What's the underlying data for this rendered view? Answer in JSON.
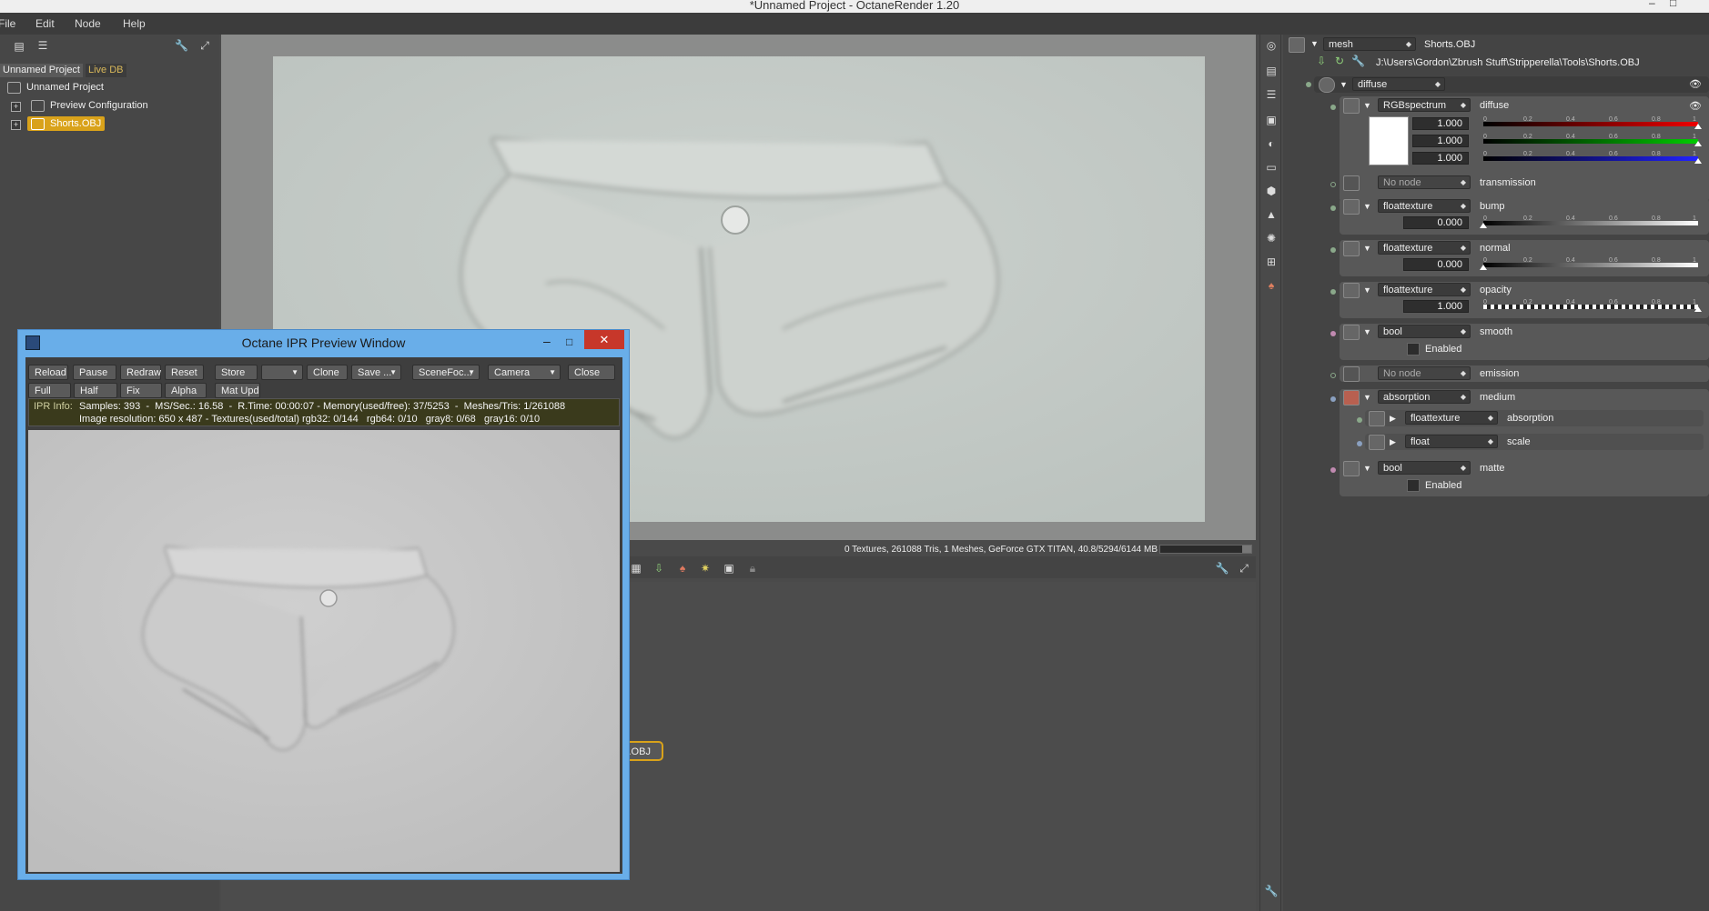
{
  "window": {
    "title": "*Unnamed Project - OctaneRender 1.20",
    "controls": {
      "minimize": "–",
      "maximize": "□"
    }
  },
  "menu": [
    "File",
    "Edit",
    "Node",
    "Help"
  ],
  "left_panel": {
    "tabs": [
      "Unnamed Project",
      "Live DB"
    ],
    "tree": {
      "root": "Unnamed Project",
      "children": [
        "Preview Configuration",
        "Shorts.OBJ"
      ]
    }
  },
  "viewport": {
    "status": "0 Textures, 261088 Tris, 1 Meshes, GeForce GTX TITAN, 40.8/5294/6144 MB",
    "node_label": "s.OBJ"
  },
  "inspector": {
    "header": {
      "node_type": "mesh",
      "node_name": "Shorts.OBJ"
    },
    "path": "J:\\Users\\Gordon\\Zbrush Stuff\\Stripperella\\Tools\\Shorts.OBJ",
    "material": "diffuse",
    "ticks": [
      "0",
      "0.2",
      "0.4",
      "0.6",
      "0.8",
      "1"
    ],
    "diffuse": {
      "type": "RGBspectrum",
      "label": "diffuse",
      "r": "1.000",
      "g": "1.000",
      "b": "1.000"
    },
    "transmission": {
      "type": "No node",
      "label": "transmission"
    },
    "bump": {
      "type": "floattexture",
      "label": "bump",
      "value": "0.000"
    },
    "normal": {
      "type": "floattexture",
      "label": "normal",
      "value": "0.000"
    },
    "opacity": {
      "type": "floattexture",
      "label": "opacity",
      "value": "1.000"
    },
    "smooth": {
      "type": "bool",
      "label": "smooth",
      "checkbox": "Enabled"
    },
    "emission": {
      "type": "No node",
      "label": "emission"
    },
    "medium": {
      "type": "absorption",
      "label": "medium",
      "absorption": {
        "type": "floattexture",
        "label": "absorption"
      },
      "scale": {
        "type": "float",
        "label": "scale"
      }
    },
    "matte": {
      "type": "bool",
      "label": "matte",
      "checkbox": "Enabled"
    }
  },
  "ipr": {
    "title": "Octane IPR Preview Window",
    "buttons_row1": [
      "Reload",
      "Pause",
      "Redraw",
      "Reset",
      "Store",
      "",
      "Clone",
      "Save ...",
      "SceneFoc...",
      "Camera",
      "Close"
    ],
    "buttons_row2": [
      "Full Upd.",
      "Half Res",
      "Fix Asp.",
      "Alpha",
      "Mat Upd"
    ],
    "info_label": "IPR Info:",
    "info_line1": "Samples: 393  -  MS/Sec.: 16.58  -  R.Time: 00:00:07 - Memory(used/free): 37/5253  -  Meshes/Tris: 1/261088",
    "info_line2": "Image resolution: 650 x 487 - Textures(used/total) rgb32: 0/144   rgb64: 0/10   gray8: 0/68   gray16: 0/10"
  },
  "colors": {
    "accent_selected": "#d9a21a",
    "ipr_frame": "#69aee9",
    "pin_green": "#8aa88a",
    "pin_pink": "#c08ab0",
    "pin_blue": "#8aa0c0"
  }
}
